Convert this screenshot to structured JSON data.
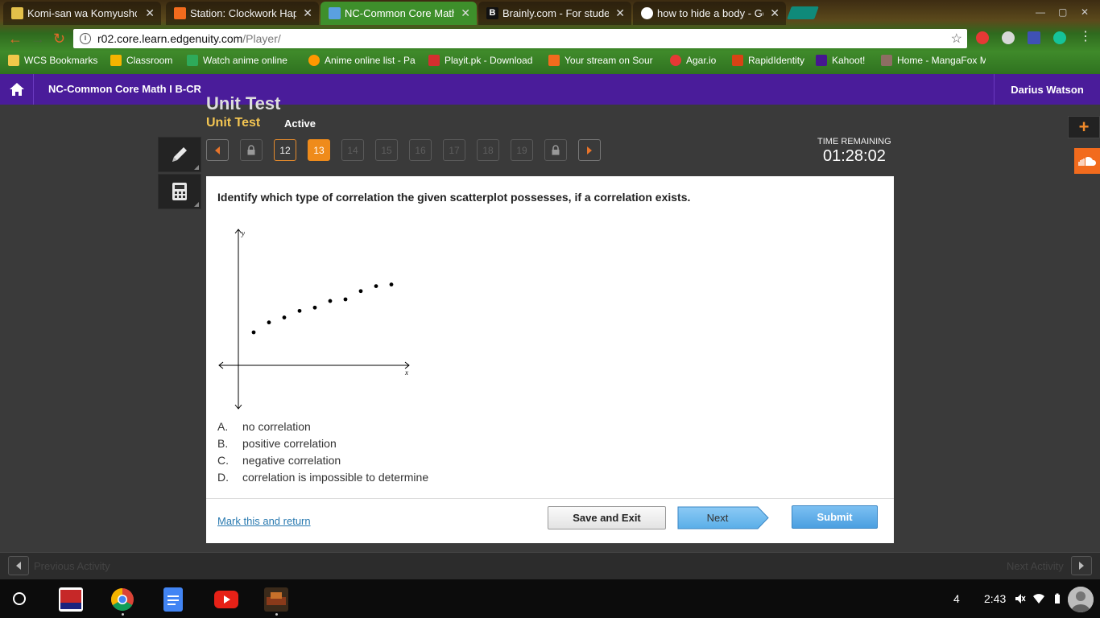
{
  "browser": {
    "tabs": [
      {
        "title": "Komi-san wa Komyusho",
        "favicon_color": "#e3c04a"
      },
      {
        "title": "Station: Clockwork Happ",
        "favicon_color": "#f26b1d"
      },
      {
        "title": "NC-Common Core Math",
        "favicon_color": "#5aa0e0",
        "active": true
      },
      {
        "title": "Brainly.com - For studen",
        "favicon_color": "#111111"
      },
      {
        "title": "how to hide a body - Go",
        "favicon_color": "#ffffff"
      }
    ],
    "url_host": "r02.core.learn.edgenuity.com",
    "url_path": "/Player/",
    "bookmarks": [
      {
        "label": "WCS Bookmarks",
        "color": "#f2c84a"
      },
      {
        "label": "Classroom",
        "color": "#f4b400"
      },
      {
        "label": "Watch anime online",
        "color": "#2eaa5a"
      },
      {
        "label": "Anime online list - Pa",
        "color": "#ff9800"
      },
      {
        "label": "Playit.pk - Download",
        "color": "#d32f2f"
      },
      {
        "label": "Your stream on Sour",
        "color": "#f26b1d"
      },
      {
        "label": "Agar.io",
        "color": "#e53935"
      },
      {
        "label": "RapidIdentity",
        "color": "#d84315"
      },
      {
        "label": "Kahoot!",
        "color": "#46178f"
      },
      {
        "label": "Home - MangaFox M",
        "color": "#8d6e63"
      }
    ]
  },
  "app": {
    "course_title": "NC-Common Core Math I B-CR",
    "user_name": "Darius Watson",
    "unit_title_cut": "Unit Test",
    "unit_title": "Unit Test",
    "unit_status": "Active",
    "questions": [
      {
        "label": "12",
        "state": "enabled"
      },
      {
        "label": "13",
        "state": "active"
      },
      {
        "label": "14",
        "state": "disabled"
      },
      {
        "label": "15",
        "state": "disabled"
      },
      {
        "label": "16",
        "state": "disabled"
      },
      {
        "label": "17",
        "state": "disabled"
      },
      {
        "label": "18",
        "state": "disabled"
      },
      {
        "label": "19",
        "state": "disabled"
      }
    ],
    "time_label": "TIME REMAINING",
    "time_value": "01:28:02",
    "question_text": "Identify which type of correlation the given scatterplot possesses, if a correlation exists.",
    "answers": [
      {
        "letter": "A.",
        "text": "no correlation"
      },
      {
        "letter": "B.",
        "text": "positive correlation"
      },
      {
        "letter": "C.",
        "text": "negative correlation"
      },
      {
        "letter": "D.",
        "text": "correlation is impossible to determine"
      }
    ],
    "mark_return": "Mark this and return",
    "save_exit": "Save and Exit",
    "next": "Next",
    "submit": "Submit",
    "prev_activity": "Previous Activity",
    "next_activity": "Next Activity",
    "colors": {
      "header": "#4a1c9a",
      "accent_orange": "#ef8b1b",
      "unit_title": "#f3c552"
    }
  },
  "chart_data": {
    "type": "scatter",
    "xlabel": "x",
    "ylabel": "y",
    "points": [
      [
        1,
        2.0
      ],
      [
        2,
        2.6
      ],
      [
        3,
        2.9
      ],
      [
        4,
        3.3
      ],
      [
        5,
        3.5
      ],
      [
        6,
        3.9
      ],
      [
        7,
        4.0
      ],
      [
        8,
        4.5
      ],
      [
        9,
        4.8
      ],
      [
        10,
        4.9
      ]
    ],
    "xlim": [
      0,
      11.5
    ],
    "ylim": [
      -1,
      10
    ]
  },
  "shelf": {
    "tray_count": "4",
    "clock": "2:43"
  }
}
